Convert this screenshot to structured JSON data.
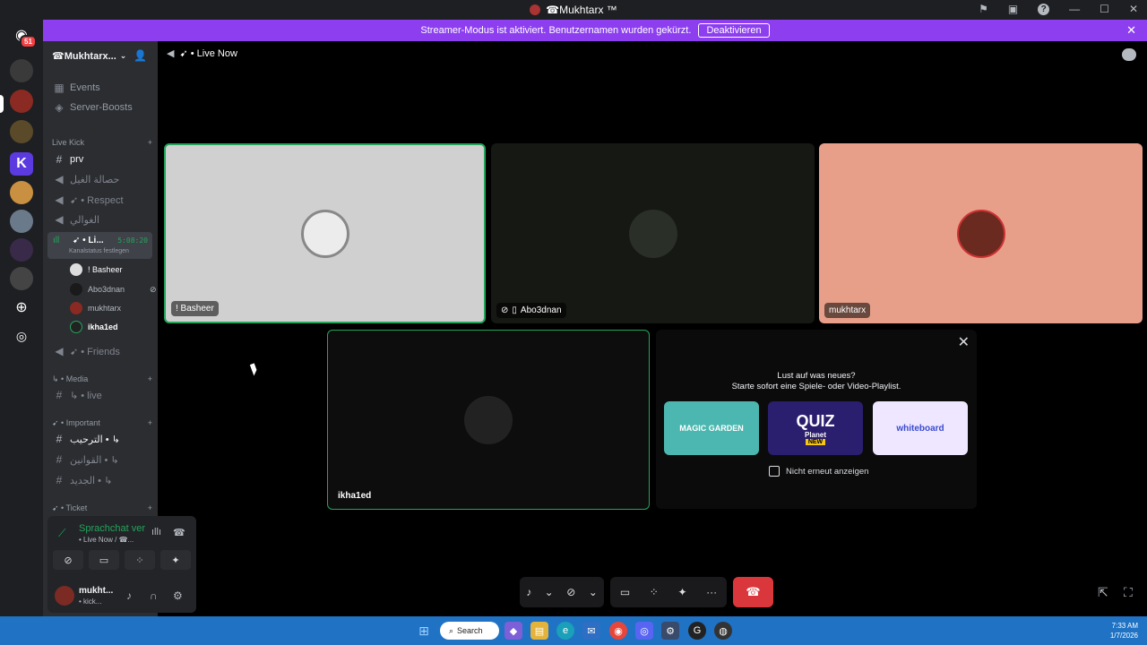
{
  "window": {
    "title": "☎Mukhtarx ™"
  },
  "banner": {
    "text": "Streamer-Modus ist aktiviert. Benutzernamen wurden gekürzt.",
    "button": "Deaktivieren"
  },
  "server_rail": {
    "badge": "51"
  },
  "server": {
    "name": "☎Mukhtarx..."
  },
  "sidebar": {
    "events": "Events",
    "boosts": "Server-Boosts",
    "cat_live_kick": "Live Kick",
    "ch_prv": "prv",
    "ch_arabic1": "حصالة الغيل",
    "ch_respect": "➹ • Respect",
    "ch_arabic2": "الغوالي",
    "live_name": "➹ • Li...",
    "live_time": "5:08:20",
    "live_status": "Kanalstatus festlegen",
    "user1": "! Basheer",
    "user2": "Abo3dnan",
    "user3": "mukhtarx",
    "user4": "ikha1ed",
    "ch_friends": "➹ • Friends",
    "cat_media": "↳ • Media",
    "ch_live": "↳ • live",
    "cat_important": "➹ • Important",
    "ch_welcome": "الترحيب • ↳",
    "ch_rules": "القوانين • ↳",
    "ch_new": "الجديد • ↳",
    "cat_ticket": "➹ • Ticket"
  },
  "voice_panel": {
    "title": "Sprachchat ver",
    "sub": "• Live Now / ☎...",
    "username": "mukht...",
    "user_status": "• kick..."
  },
  "call": {
    "header": "➹ • Live Now"
  },
  "tiles": {
    "basheer": "! Basheer",
    "abo3dnan": "Abo3dnan",
    "mukhtarx": "mukhtarx",
    "ikhaled": "ikha1ed"
  },
  "promo": {
    "line1": "Lust auf was neues?",
    "line2": "Starte sofort eine Spiele- oder Video-Playlist.",
    "act1": "MAGIC GARDEN",
    "act2": "QUIZ",
    "act2_sub": "Planet",
    "act2_badge": "NEW",
    "act3": "whiteboard",
    "checkbox": "Nicht erneut anzeigen"
  },
  "taskbar": {
    "search": "Search",
    "time": "7:33 AM",
    "date": "1/7/2026"
  }
}
